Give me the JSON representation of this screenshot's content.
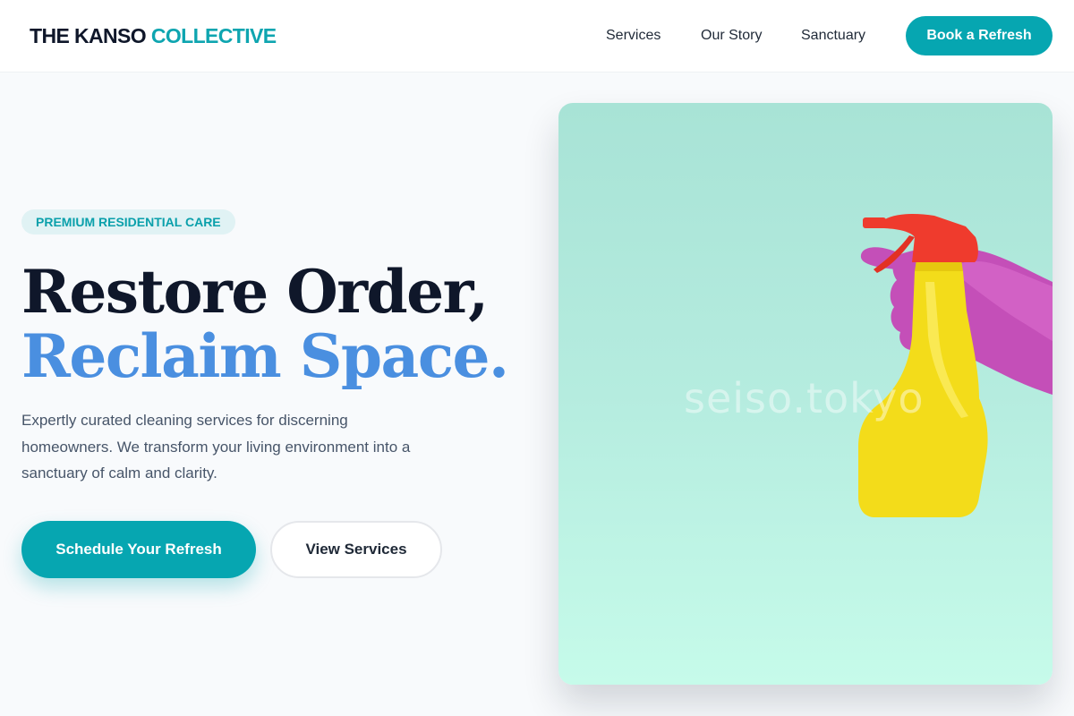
{
  "header": {
    "logo_primary": "THE KANSO",
    "logo_accent": "COLLECTIVE",
    "nav": [
      {
        "label": "Services"
      },
      {
        "label": "Our Story"
      },
      {
        "label": "Sanctuary"
      }
    ],
    "cta_label": "Book a Refresh"
  },
  "hero": {
    "badge": "PREMIUM RESIDENTIAL CARE",
    "headline_line1": "Restore Order,",
    "headline_line2": "Reclaim Space.",
    "description": "Expertly curated cleaning services for discerning homeowners. We transform your living environment into a sanctuary of calm and clarity.",
    "primary_cta": "Schedule Your Refresh",
    "secondary_cta": "View Services",
    "image": {
      "watermark": "seiso.tokyo",
      "subject": "yellow spray bottle held by purple-gloved hand"
    }
  },
  "colors": {
    "accent": "#06a6b1",
    "headline_dark": "#0f172a",
    "headline_blue": "#4a8fe0",
    "background": "#f8fafc",
    "badge_bg": "#e0f2f4"
  },
  "icons": [
    "spray-bottle-icon",
    "glove-icon"
  ]
}
